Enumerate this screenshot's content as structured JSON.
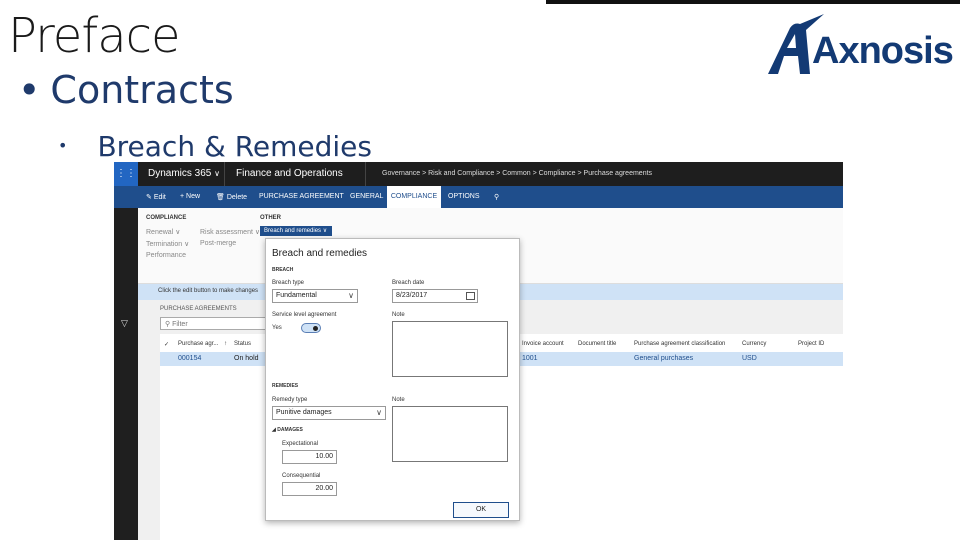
{
  "slide": {
    "title": "Preface",
    "bullet1": "Contracts",
    "bullet2": "Breach & Remedies",
    "bullet_char": "•",
    "logo_text": "Axnosis"
  },
  "app": {
    "brand": "Dynamics 365",
    "module": "Finance and Operations",
    "breadcrumb": "Governance  >  Risk and Compliance  >  Common  >  Compliance  >  Purchase agreements",
    "actions": {
      "edit": "Edit",
      "new": "New",
      "delete": "Delete",
      "purchase_agreement": "PURCHASE AGREEMENT",
      "general": "GENERAL",
      "compliance": "COMPLIANCE",
      "options": "OPTIONS"
    },
    "ribbon": {
      "compliance_header": "COMPLIANCE",
      "other_header": "OTHER",
      "renewal": "Renewal",
      "risk_assessment": "Risk assessment",
      "termination": "Termination",
      "post_merge": "Post-merge",
      "performance": "Performance",
      "breach_btn": "Breach and remedies"
    },
    "infobar": "Click the edit button to make changes",
    "list_label": "PURCHASE AGREEMENTS",
    "filter_placeholder": "Filter",
    "grid_headers": {
      "purchase_agr": "Purchase agr...",
      "status": "Status",
      "invoice_account": "Invoice account",
      "document_title": "Document title",
      "classification": "Purchase agreement classification",
      "currency": "Currency",
      "project_id": "Project ID"
    },
    "grid_row": {
      "id": "000154",
      "status": "On hold",
      "invoice_account": "1001",
      "classification": "General purchases",
      "currency": "USD"
    }
  },
  "dialog": {
    "title": "Breach and remedies",
    "breach_section": "BREACH",
    "breach_type_label": "Breach type",
    "breach_type_value": "Fundamental",
    "breach_date_label": "Breach date",
    "breach_date_value": "8/23/2017",
    "sla_label": "Service level agreement",
    "sla_value": "Yes",
    "note_label": "Note",
    "remedies_section": "REMEDIES",
    "remedy_type_label": "Remedy type",
    "remedy_type_value": "Punitive damages",
    "note2_label": "Note",
    "damages_section": "DAMAGES",
    "expectational_label": "Expectational",
    "expectational_value": "10.00",
    "consequential_label": "Consequential",
    "consequential_value": "20.00",
    "ok_label": "OK"
  }
}
